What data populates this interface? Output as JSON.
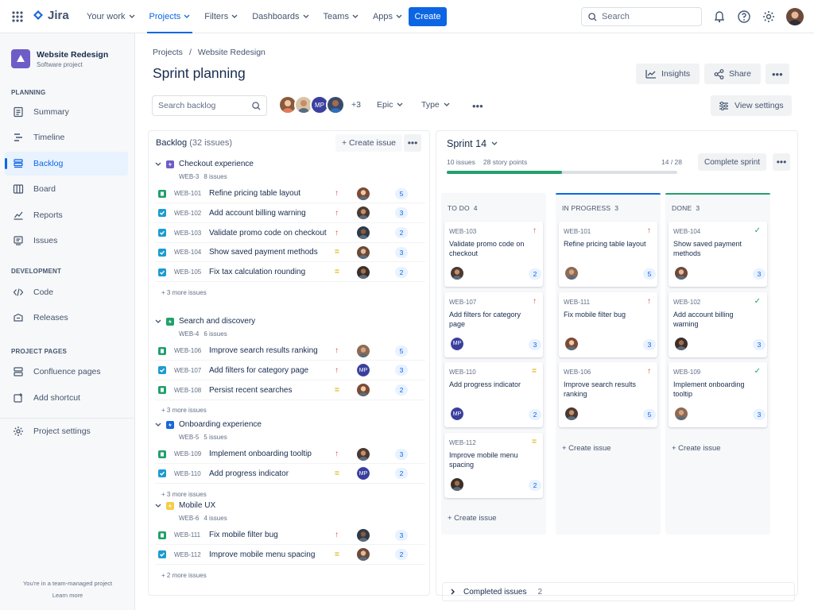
{
  "topbar": {
    "logo": "Jira",
    "nav": [
      {
        "label": "Your work",
        "active": false
      },
      {
        "label": "Projects",
        "active": true
      },
      {
        "label": "Filters",
        "active": false
      },
      {
        "label": "Dashboards",
        "active": false
      },
      {
        "label": "Teams",
        "active": false
      },
      {
        "label": "Apps",
        "active": false
      }
    ],
    "create": "Create",
    "search_placeholder": "Search"
  },
  "sidebar": {
    "project_name": "Website Redesign",
    "project_type": "Software project",
    "planning_label": "PLANNING",
    "planning": [
      {
        "label": "Summary",
        "icon": "summary-icon"
      },
      {
        "label": "Timeline",
        "icon": "timeline-icon"
      },
      {
        "label": "Backlog",
        "icon": "backlog-icon",
        "active": true
      },
      {
        "label": "Board",
        "icon": "board-icon"
      },
      {
        "label": "Reports",
        "icon": "reports-icon"
      },
      {
        "label": "Issues",
        "icon": "issues-icon"
      }
    ],
    "development_label": "DEVELOPMENT",
    "development": [
      {
        "label": "Code",
        "icon": "code-icon"
      },
      {
        "label": "Releases",
        "icon": "releases-icon"
      }
    ],
    "pages_label": "PROJECT PAGES",
    "pages": [
      {
        "label": "Confluence pages",
        "icon": "confluence-icon"
      },
      {
        "label": "Add shortcut",
        "icon": "add-shortcut-icon"
      }
    ],
    "settings": "Project settings",
    "footer_text": "You're in a team-managed project",
    "footer_link": "Learn more"
  },
  "header": {
    "breadcrumb": [
      "Projects",
      "/",
      "Website Redesign"
    ],
    "title": "Sprint planning",
    "insights": "Insights",
    "share": "Share",
    "search_placeholder": "Search backlog",
    "avatars_more": "+3",
    "avatar_initials": "MP",
    "epic_filter": "Epic",
    "type_filter": "Type",
    "view_settings": "View settings"
  },
  "backlog": {
    "title": "Backlog",
    "count": "(32 issues)",
    "create": "+ Create issue",
    "epics": [
      {
        "name": "Checkout experience",
        "key": "WEB-3",
        "count": "8 issues",
        "color": "#6e5dc6",
        "rows": [
          {
            "key": "WEB-101",
            "title": "Refine pricing table layout",
            "type": "story",
            "prio": "high",
            "pts": "5"
          },
          {
            "key": "WEB-102",
            "title": "Add account billing warning",
            "type": "task",
            "prio": "high",
            "pts": "3"
          },
          {
            "key": "WEB-103",
            "title": "Validate promo code on checkout",
            "type": "task",
            "prio": "high",
            "pts": "2"
          },
          {
            "key": "WEB-104",
            "title": "Show saved payment methods",
            "type": "task",
            "prio": "medium",
            "pts": "3"
          },
          {
            "key": "WEB-105",
            "title": "Fix tax calculation rounding",
            "type": "task",
            "prio": "medium",
            "pts": "2"
          }
        ],
        "more": "+ 3 more issues"
      },
      {
        "name": "Search and discovery",
        "key": "WEB-4",
        "count": "6 issues",
        "color": "#22a06b",
        "rows": [
          {
            "key": "WEB-106",
            "title": "Improve search results ranking",
            "type": "story",
            "prio": "high",
            "pts": "5"
          },
          {
            "key": "WEB-107",
            "title": "Add filters for category page",
            "type": "task",
            "prio": "high",
            "pts": "3"
          },
          {
            "key": "WEB-108",
            "title": "Persist recent searches",
            "type": "story",
            "prio": "medium",
            "pts": "2"
          }
        ],
        "more": "+ 3 more issues"
      },
      {
        "name": "Onboarding experience",
        "key": "WEB-5",
        "count": "5 issues",
        "color": "#1868db",
        "rows": [
          {
            "key": "WEB-109",
            "title": "Implement onboarding tooltip",
            "type": "story",
            "prio": "high",
            "pts": "3"
          },
          {
            "key": "WEB-110",
            "title": "Add progress indicator",
            "type": "task",
            "prio": "medium",
            "pts": "2"
          }
        ],
        "more": "+ 3 more issues"
      },
      {
        "name": "Mobile UX",
        "key": "WEB-6",
        "count": "4 issues",
        "color": "#f5cd47",
        "rows": [
          {
            "key": "WEB-111",
            "title": "Fix mobile filter bug",
            "type": "story",
            "prio": "high",
            "pts": "3"
          },
          {
            "key": "WEB-112",
            "title": "Improve mobile menu spacing",
            "type": "task",
            "prio": "medium",
            "pts": "2"
          }
        ],
        "more": "+ 2 more issues"
      }
    ]
  },
  "sprint": {
    "name": "Sprint 14",
    "issues": "10 issues",
    "points": "28 story points",
    "progress_done": 14,
    "progress_total": 28,
    "progress_text": "14 / 28",
    "complete": "Complete sprint",
    "columns": [
      {
        "name": "TO DO",
        "count": "4",
        "accent": "",
        "cards": [
          {
            "key": "WEB-103",
            "title": "Validate promo code on checkout",
            "prio": "high",
            "pts": "2",
            "avatar": "photo"
          },
          {
            "key": "WEB-107",
            "title": "Add filters for category page",
            "prio": "high",
            "pts": "3",
            "avatar": "MP"
          },
          {
            "key": "WEB-110",
            "title": "Add progress indicator",
            "prio": "medium",
            "pts": "2",
            "avatar": "MP"
          },
          {
            "key": "WEB-112",
            "title": "Improve mobile menu spacing",
            "prio": "medium",
            "pts": "2",
            "avatar": "photo"
          }
        ],
        "create": "+ Create issue"
      },
      {
        "name": "IN PROGRESS",
        "count": "3",
        "accent": "#0c66e4",
        "cards": [
          {
            "key": "WEB-101",
            "title": "Refine pricing table layout",
            "prio": "high",
            "pts": "5",
            "avatar": "photo"
          },
          {
            "key": "WEB-111",
            "title": "Fix mobile filter bug",
            "prio": "high",
            "pts": "3",
            "avatar": "photo"
          },
          {
            "key": "WEB-106",
            "title": "Improve search results ranking",
            "prio": "high",
            "pts": "5",
            "avatar": "photo"
          }
        ],
        "create": "+ Create issue"
      },
      {
        "name": "DONE",
        "count": "3",
        "accent": "#22a06b",
        "cards": [
          {
            "key": "WEB-104",
            "title": "Show saved payment methods",
            "prio": "done",
            "pts": "3",
            "avatar": "photo"
          },
          {
            "key": "WEB-102",
            "title": "Add account billing warning",
            "prio": "done",
            "pts": "3",
            "avatar": "photo"
          },
          {
            "key": "WEB-109",
            "title": "Implement onboarding tooltip",
            "prio": "done",
            "pts": "3",
            "avatar": "photo"
          }
        ],
        "create": "+ Create issue"
      }
    ],
    "completed_label": "Completed issues",
    "completed_count": "2"
  },
  "colors": {
    "brand": "#0c66e4",
    "high": "#e2483d",
    "medium": "#e2b203",
    "done": "#22a06b",
    "story": "#22a06b",
    "task": "#1d9bd1"
  }
}
